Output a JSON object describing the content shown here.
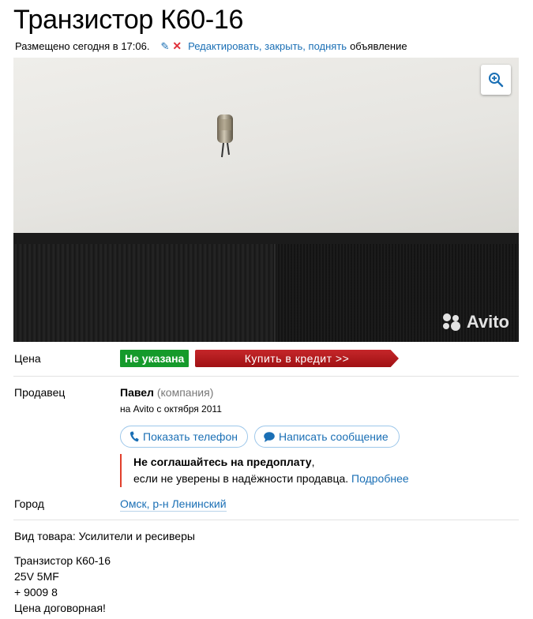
{
  "listing": {
    "title": "Транзистор К60-16",
    "placed": "Размещено сегодня в 17:06.",
    "actions_link": "Редактировать, закрыть, поднять",
    "actions_suffix": "объявление"
  },
  "photo": {
    "watermark": "Avito",
    "zoom_icon": "zoom-in-icon"
  },
  "price": {
    "label": "Цена",
    "value": "Не указана",
    "credit_button": "Купить в кредит >>"
  },
  "seller": {
    "label": "Продавец",
    "name": "Павел",
    "type": "(компания)",
    "since": "на Avito с октября 2011",
    "show_phone": "Показать телефон",
    "write_message": "Написать сообщение",
    "warning_bold": "Не соглашайтесь на предоплату",
    "warning_comma": ",",
    "warning_text": "если не уверены в надёжности продавца.",
    "warning_link": "Подробнее"
  },
  "city": {
    "label": "Город",
    "value": "Омск, р-н Ленинский"
  },
  "description": {
    "category": "Вид товара: Усилители и ресиверы",
    "lines": [
      "Транзистор К60-16",
      "25V 5MF",
      "+ 9009 8",
      "Цена договорная!"
    ]
  },
  "colors": {
    "link": "#1a6fb5",
    "price_badge": "#159a2b",
    "credit_button": "#b5181c",
    "warning_bar": "#e13f2b"
  }
}
